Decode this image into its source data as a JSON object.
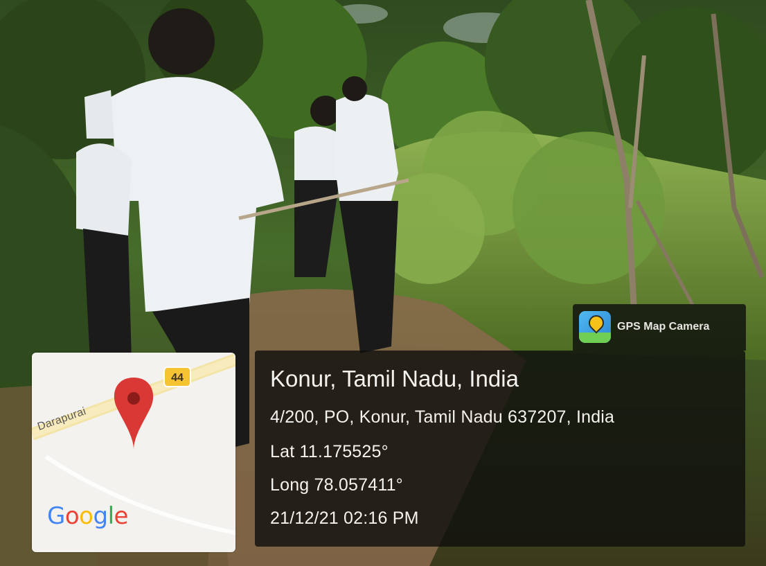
{
  "map": {
    "road_label": "Darapurai",
    "highway_number": "44",
    "brand_letters": [
      {
        "char": "G",
        "color": "#4285f4"
      },
      {
        "char": "o",
        "color": "#ea4335"
      },
      {
        "char": "o",
        "color": "#fbbc05"
      },
      {
        "char": "g",
        "color": "#4285f4"
      },
      {
        "char": "l",
        "color": "#34a853"
      },
      {
        "char": "e",
        "color": "#ea4335"
      }
    ],
    "pin_color": "#d93834"
  },
  "app_badge": {
    "name": "GPS Map Camera",
    "icon": "gps-map-camera-app-icon"
  },
  "location": {
    "title": "Konur, Tamil Nadu, India",
    "address": "4/200, PO, Konur, Tamil Nadu 637207, India",
    "latitude": "Lat 11.175525°",
    "longitude": "Long 78.057411°",
    "timestamp": "21/12/21 02:16 PM"
  }
}
